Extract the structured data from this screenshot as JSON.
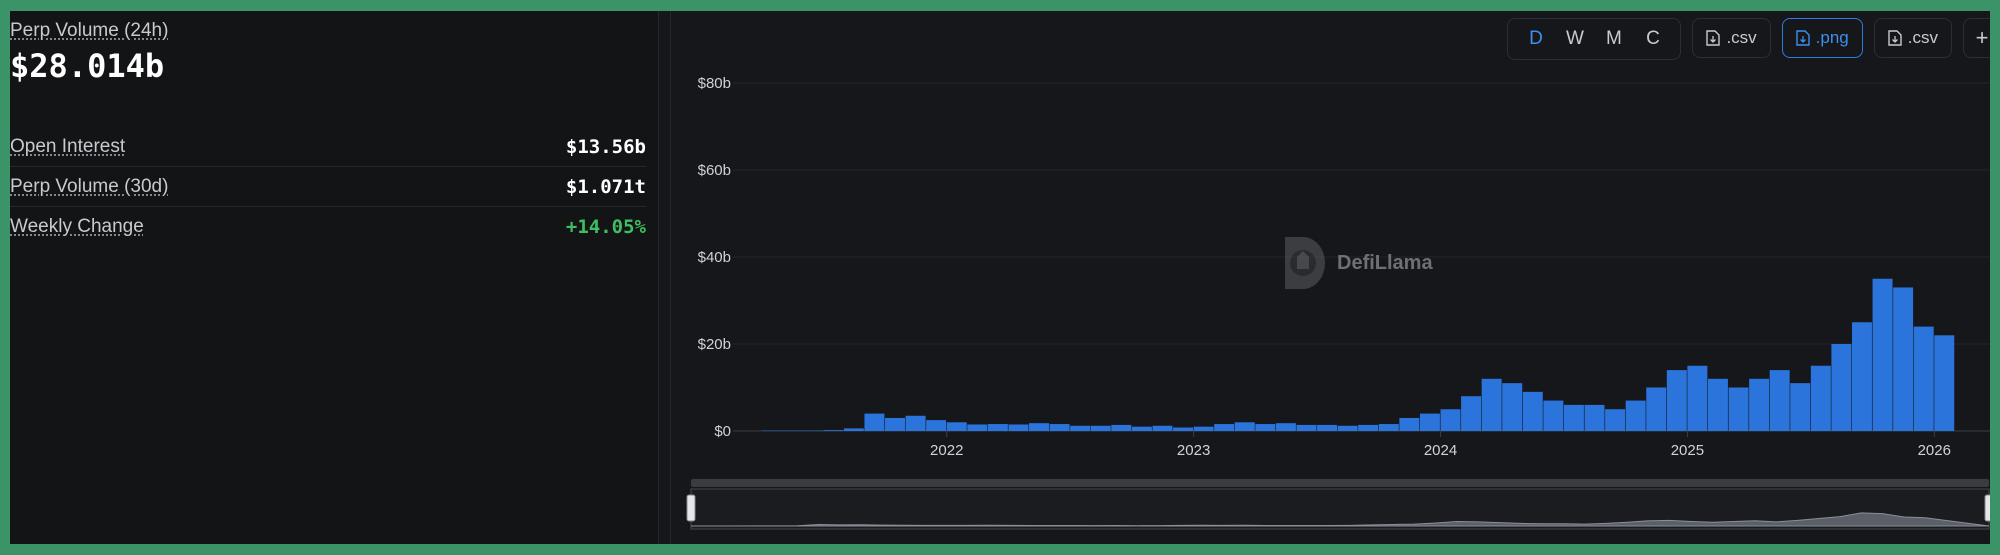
{
  "stats": {
    "main": {
      "label": "Perp Volume (24h)",
      "value": "$28.014b"
    },
    "rows": [
      {
        "label": "Open Interest",
        "value": "$13.56b"
      },
      {
        "label": "Perp Volume (30d)",
        "value": "$1.071t"
      },
      {
        "label": "Weekly Change",
        "value": "+14.05%"
      }
    ]
  },
  "toolbar": {
    "granularity": [
      "D",
      "W",
      "M",
      "C"
    ],
    "granularity_active": "D",
    "buttons": [
      {
        "label": ".csv",
        "icon": "file-download-icon",
        "active": false
      },
      {
        "label": ".png",
        "icon": "file-download-icon",
        "active": true
      },
      {
        "label": ".csv",
        "icon": "file-download-icon",
        "active": false
      }
    ],
    "plus_label": "+"
  },
  "watermark": {
    "text": "DefiLlama"
  },
  "colors": {
    "accent": "#2f7be5",
    "bar": "#2a74dc",
    "positive": "#3fbd62",
    "background": "#16171a"
  },
  "chart_data": {
    "type": "bar",
    "title": "",
    "xlabel": "",
    "ylabel": "",
    "y_tick_labels": [
      "$0",
      "$20b",
      "$40b",
      "$60b",
      "$80b"
    ],
    "x_tick_labels": [
      "2022",
      "2023",
      "2024",
      "2025",
      "2026"
    ],
    "ylim": [
      0,
      80
    ],
    "y_unit": "billion USD",
    "grid": true,
    "x": [
      "2021-04",
      "2021-07",
      "2021-08",
      "2021-09",
      "2021-10",
      "2021-11",
      "2021-12",
      "2022-01",
      "2022-02",
      "2022-03",
      "2022-04",
      "2022-05",
      "2022-06",
      "2022-07",
      "2022-08",
      "2022-09",
      "2022-10",
      "2022-11",
      "2022-12",
      "2023-01",
      "2023-02",
      "2023-03",
      "2023-04",
      "2023-05",
      "2023-06",
      "2023-07",
      "2023-08",
      "2023-09",
      "2023-10",
      "2023-11",
      "2023-12",
      "2024-01",
      "2024-02",
      "2024-03",
      "2024-04",
      "2024-05",
      "2024-06",
      "2024-07",
      "2024-08",
      "2024-09",
      "2024-10",
      "2024-11",
      "2024-12",
      "2025-01",
      "2025-02",
      "2025-03",
      "2025-04",
      "2025-05",
      "2025-06",
      "2025-07",
      "2025-08",
      "2025-09",
      "2025-10",
      "2025-11",
      "2025-12",
      "2026-01"
    ],
    "series": [
      {
        "values": [
          0.1,
          0.2,
          0.6,
          4,
          3,
          3.5,
          2.5,
          2,
          1.5,
          1.6,
          1.5,
          1.8,
          1.6,
          1.2,
          1.2,
          1.4,
          1,
          1.2,
          0.8,
          1,
          1.6,
          2,
          1.6,
          1.8,
          1.4,
          1.4,
          1.2,
          1.4,
          1.6,
          3,
          4,
          5,
          8,
          12,
          11,
          9,
          7,
          6,
          6,
          5,
          7,
          10,
          14,
          15,
          12,
          10,
          12,
          14,
          11,
          15,
          20,
          25,
          35,
          33,
          24,
          22
        ]
      }
    ]
  }
}
